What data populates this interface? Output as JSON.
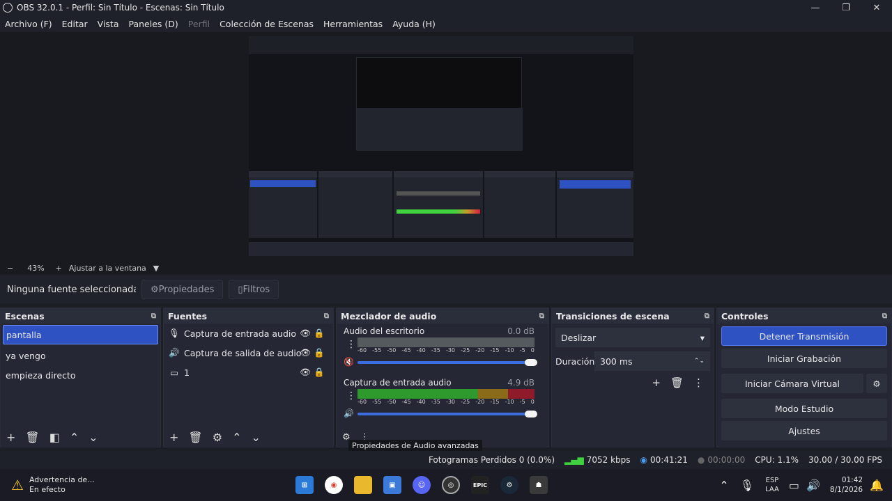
{
  "window": {
    "title": "OBS 32.0.1 - Perfil: Sin Título - Escenas: Sin Título"
  },
  "menu": [
    "Archivo (F)",
    "Editar",
    "Vista",
    "Paneles (D)",
    "Perfil",
    "Colección de Escenas",
    "Herramientas",
    "Ayuda (H)"
  ],
  "zoom": {
    "minus": "−",
    "value": "43%",
    "plus": "+",
    "fit": "Ajustar a la ventana"
  },
  "source_bar": {
    "none": "Ninguna fuente seleccionada",
    "properties": "Propiedades",
    "filters": "Filtros"
  },
  "scenes": {
    "title": "Escenas",
    "items": [
      "pantalla",
      "ya vengo",
      "empieza directo"
    ]
  },
  "sources": {
    "title": "Fuentes",
    "items": [
      "Captura de entrada audio",
      "Captura de salida de audio",
      "1"
    ]
  },
  "mixer": {
    "title": "Mezclador de audio",
    "scale": [
      "-60",
      "-55",
      "-50",
      "-45",
      "-40",
      "-35",
      "-30",
      "-25",
      "-20",
      "-15",
      "-10",
      "-5",
      "0"
    ],
    "channels": [
      {
        "name": "Audio del escritorio",
        "db": "0.0 dB",
        "level": 0.0
      },
      {
        "name": "Captura de entrada audio",
        "db": "4.9 dB",
        "level": 0.98
      }
    ]
  },
  "transitions": {
    "title": "Transiciones de escena",
    "type": "Deslizar",
    "duration_label": "Duración",
    "duration": "300 ms"
  },
  "controls": {
    "title": "Controles",
    "buttons": [
      "Detener Transmisión",
      "Iniciar Grabación",
      "Iniciar Cámara Virtual",
      "Modo Estudio",
      "Ajustes"
    ]
  },
  "tooltip": "Propiedades de Audio avanzadas",
  "status": {
    "dropped": "Fotogramas Perdidos 0 (0.0%)",
    "bitrate": "7052 kbps",
    "live": "00:41:21",
    "rec": "00:00:00",
    "cpu": "CPU: 1.1%",
    "fps": "30.00 / 30.00 FPS"
  },
  "taskbar": {
    "notice_title": "Advertencia de...",
    "notice_sub": "En efecto",
    "lang": "ESP",
    "region": "LAA",
    "time": "01:42",
    "date": "8/1/2026"
  },
  "colors": {
    "accent": "#2f52c2",
    "green": "#3fd13f",
    "red": "#d61f3a"
  }
}
